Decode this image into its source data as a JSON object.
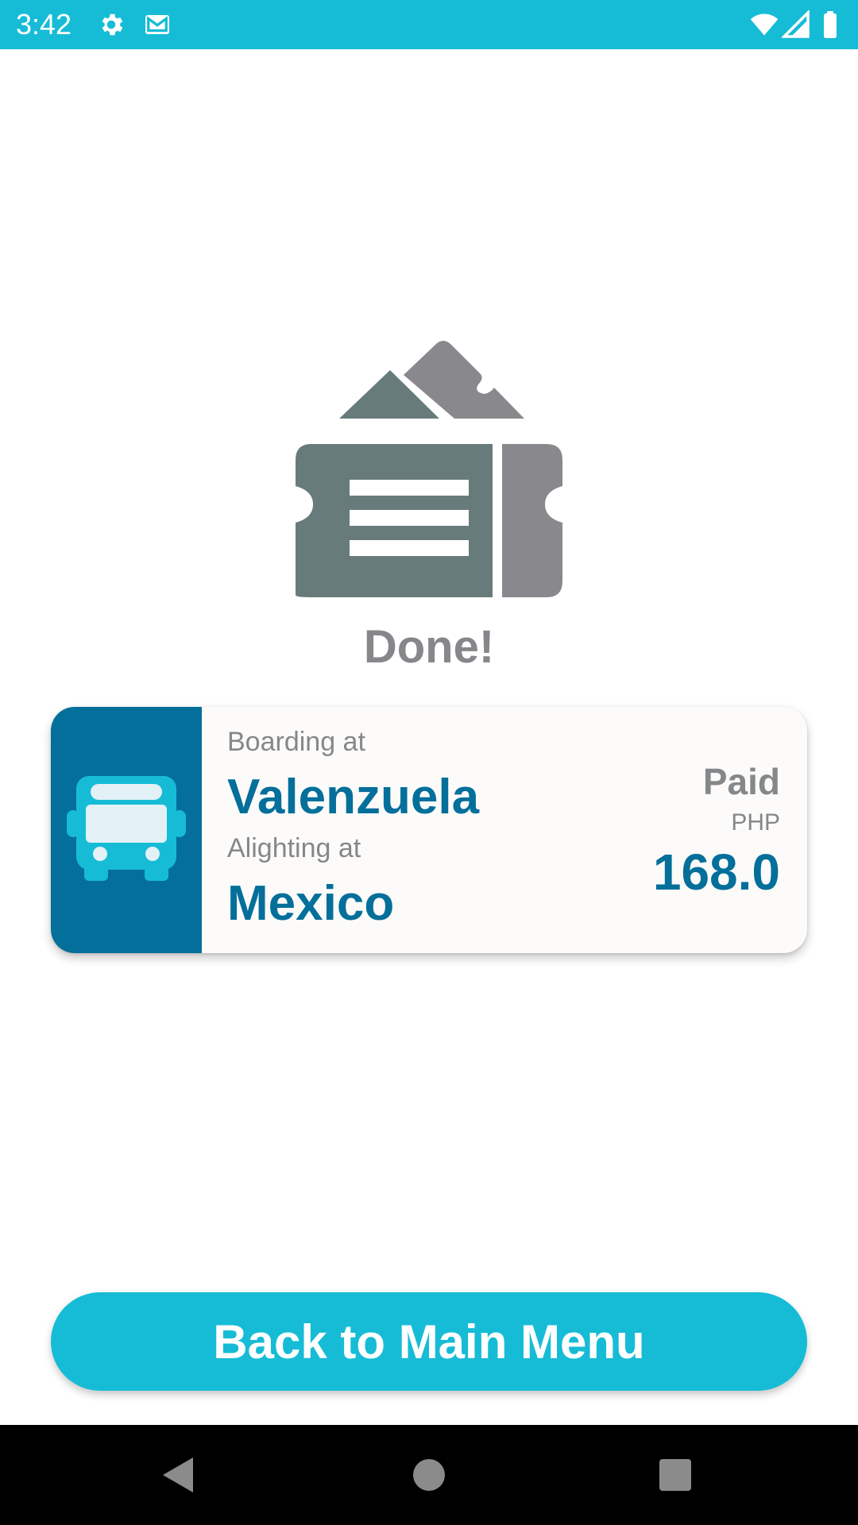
{
  "status_bar": {
    "time": "3:42",
    "icons": [
      "gear-icon",
      "mail-icon",
      "wifi-icon",
      "signal-icon",
      "battery-icon"
    ],
    "background_color": "#16bcd6"
  },
  "illustration": {
    "icon": "ticket-icon"
  },
  "done_title": "Done!",
  "trip_card": {
    "icon": "bus-icon",
    "boarding_label": "Boarding at",
    "boarding_place": "Valenzuela",
    "alighting_label": "Alighting at",
    "alighting_place": "Mexico",
    "paid_label": "Paid",
    "currency": "PHP",
    "amount": "168.0",
    "accent_color": "#046f9a"
  },
  "main_menu_button": {
    "label": "Back to Main Menu",
    "color": "#16bcd6"
  },
  "nav_bar": {
    "icons": [
      "back-icon",
      "home-icon",
      "recents-icon"
    ]
  }
}
